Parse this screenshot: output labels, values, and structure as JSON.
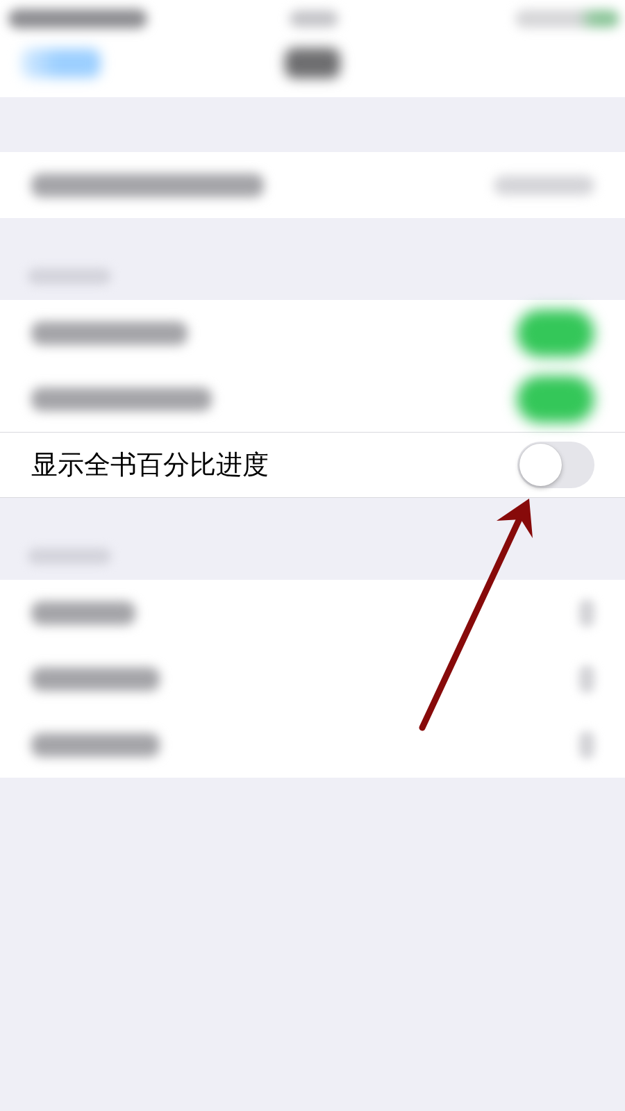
{
  "status_bar": {
    "blurred": true
  },
  "nav_bar": {
    "blurred": true
  },
  "groups": [
    {
      "header": false,
      "rows": [
        {
          "kind": "value",
          "blurred": true
        }
      ]
    },
    {
      "header": true,
      "rows": [
        {
          "kind": "toggle",
          "blurred": true,
          "on": true
        },
        {
          "kind": "toggle",
          "blurred": true,
          "on": true
        },
        {
          "kind": "toggle",
          "blurred": false,
          "on": false,
          "label": "显示全书百分比进度"
        }
      ]
    },
    {
      "header": true,
      "rows": [
        {
          "kind": "chevron",
          "blurred": true
        },
        {
          "kind": "chevron",
          "blurred": true
        },
        {
          "kind": "chevron",
          "blurred": true
        }
      ]
    }
  ],
  "annotations": [
    {
      "kind": "arrow"
    }
  ]
}
